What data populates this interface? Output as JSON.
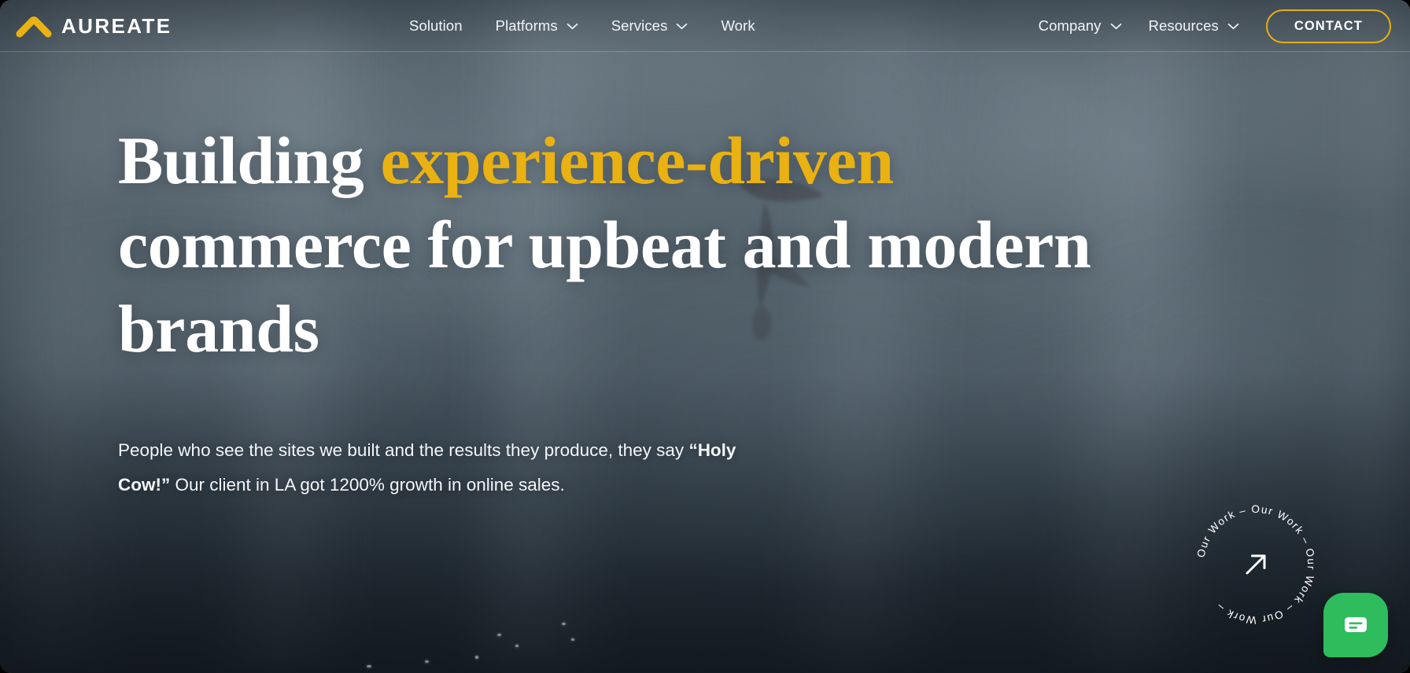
{
  "brand": {
    "name": "AUREATE",
    "mark_icon": "chevron-up-logo-icon",
    "mark_color": "#e9b111"
  },
  "header": {
    "nav_center": [
      {
        "label": "Solution",
        "has_dropdown": false
      },
      {
        "label": "Platforms",
        "has_dropdown": true
      },
      {
        "label": "Services",
        "has_dropdown": true
      },
      {
        "label": "Work",
        "has_dropdown": false
      }
    ],
    "nav_right": [
      {
        "label": "Company",
        "has_dropdown": true
      },
      {
        "label": "Resources",
        "has_dropdown": true
      }
    ],
    "contact_label": "CONTACT",
    "contact_border_color": "#e6ae10"
  },
  "hero": {
    "headline": {
      "line1_plain": "Building ",
      "line1_accent": "experience-driven",
      "line2": "commerce for upbeat and modern",
      "line3": "brands",
      "accent_color": "#e9b111",
      "text_color": "#ffffff"
    },
    "subcopy": {
      "part1": "People who see the sites we built and the results they produce, they say ",
      "emphasis": "“Holy Cow!”",
      "part2": " Our client in LA got 1200% growth in online sales."
    }
  },
  "work_badge": {
    "circular_text": "Our Work  –  Our Work  –  Our Work  –  Our Work  –  ",
    "arrow_icon": "arrow-up-right-icon",
    "label": "Our Work"
  },
  "chat": {
    "icon": "chat-bubble-icon",
    "color": "#2fbc5d"
  },
  "theme": {
    "background_top": "#5c6b75",
    "background_bottom": "#242f38",
    "accent": "#e9b111"
  }
}
